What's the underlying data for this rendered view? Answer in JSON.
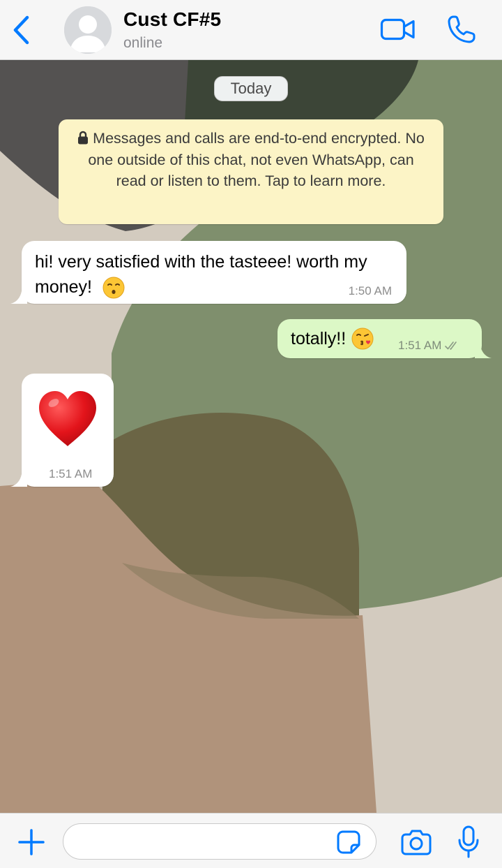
{
  "header": {
    "contact_name": "Cust CF#5",
    "status": "online",
    "icons": {
      "back": "chevron-left-icon",
      "avatar": "person-silhouette-icon",
      "video": "video-camera-icon",
      "call": "phone-icon"
    }
  },
  "chat": {
    "day_label": "Today",
    "encryption_notice": "Messages and calls are end-to-end encrypted. No one outside of this chat, not even WhatsApp, can read or listen to them. Tap to learn more.",
    "messages": [
      {
        "direction": "incoming",
        "text": "hi! very satisfied with the tasteee! worth my money!",
        "emoji": "kissing-face",
        "time": "1:50 AM"
      },
      {
        "direction": "outgoing",
        "text": "totally!!",
        "emoji": "face-blowing-kiss",
        "time": "1:51 AM",
        "status": "read-double-check"
      },
      {
        "direction": "incoming",
        "emoji": "red-heart",
        "time": "1:51 AM"
      }
    ]
  },
  "composer": {
    "input_value": "",
    "icons": {
      "attach": "plus-icon",
      "sticker": "sticker-icon",
      "camera": "camera-icon",
      "mic": "microphone-icon"
    }
  },
  "colors": {
    "accent": "#007aff",
    "incoming_bubble": "#ffffff",
    "outgoing_bubble": "#dcf8c6",
    "notice_bubble": "#fcf4c6",
    "header_bg": "#f6f6f6"
  }
}
